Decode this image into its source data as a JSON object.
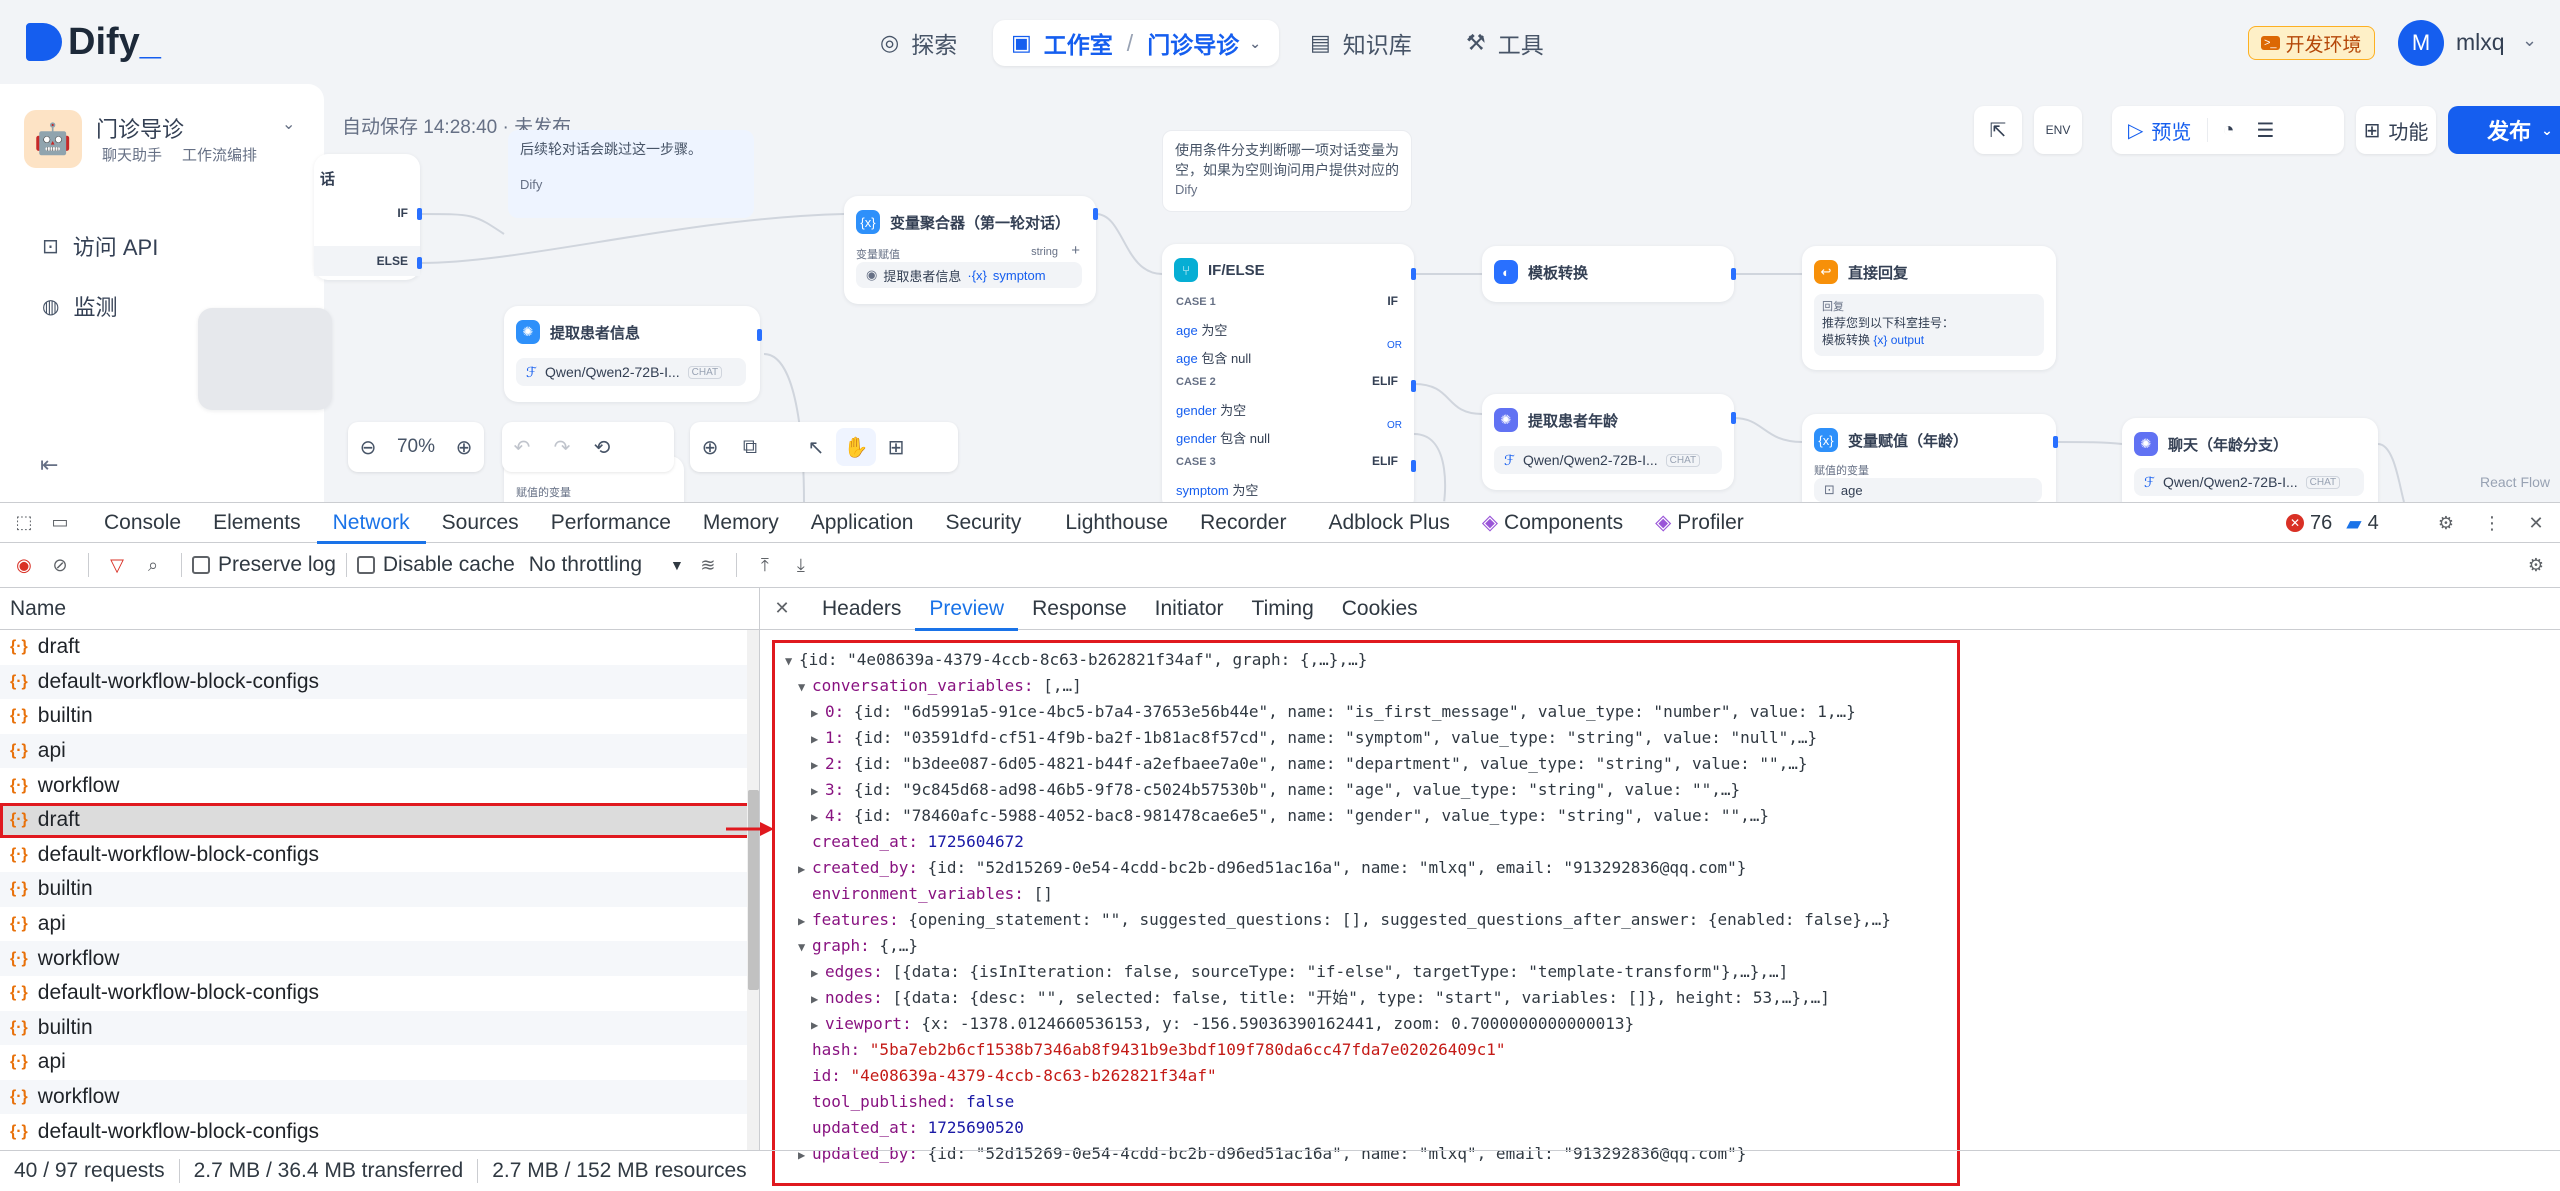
{
  "dify": {
    "brand": "Dify",
    "nav": {
      "explore": "探索",
      "studio": "工作室",
      "studio_app": "门诊导诊",
      "knowledge": "知识库",
      "tools": "工具"
    },
    "env_badge": "开发环境",
    "user": {
      "initial": "M",
      "name": "mlxq"
    },
    "sidebar": {
      "app_name": "门诊导诊",
      "app_tag1": "聊天助手",
      "app_tag2": "工作流编排",
      "items": [
        {
          "label": "访问 API",
          "icon": "terminal-icon"
        },
        {
          "label": "监测",
          "icon": "monitor-icon"
        }
      ]
    },
    "canvas": {
      "autosave": "自动保存 14:28:40 · 未发布",
      "toolbar": {
        "preview": "预览",
        "features": "功能",
        "publish": "发布"
      },
      "zoom": "70%",
      "react_flow": "React Flow",
      "notes": {
        "left_note": "后续轮对话会跳过这一步骤。",
        "left_note_author": "Dify",
        "right_note": "使用条件分支判断哪一项对话变量为空，如果为空则询问用户提供对应的",
        "right_note_author": "Dify"
      },
      "nodes": {
        "if_partial": {
          "title": "话",
          "if": "IF",
          "else": "ELSE"
        },
        "extract_patient": {
          "title": "提取患者信息",
          "model": "Qwen/Qwen2-72B-I...",
          "badge": "CHAT"
        },
        "var_aggregator": {
          "title": "变量聚合器（第一轮对话）",
          "label": "变量赋值",
          "type": "string",
          "var_src": "提取患者信息",
          "var": "symptom"
        },
        "ifelse": {
          "title": "IF/ELSE",
          "cases": [
            {
              "name": "CASE 1",
              "tag": "IF",
              "conds": [
                {
                  "var": "age",
                  "op": "为空"
                },
                {
                  "var": "age",
                  "op": "包含 null"
                }
              ]
            },
            {
              "name": "CASE 2",
              "tag": "ELIF",
              "conds": [
                {
                  "var": "gender",
                  "op": "为空"
                },
                {
                  "var": "gender",
                  "op": "包含 null"
                }
              ]
            },
            {
              "name": "CASE 3",
              "tag": "ELIF",
              "conds": [
                {
                  "var": "symptom",
                  "op": "为空"
                }
              ]
            }
          ],
          "or": "OR"
        },
        "template": {
          "title": "模板转换"
        },
        "direct_reply": {
          "title": "直接回复",
          "label": "回复",
          "text": "推荐您到以下科室挂号：",
          "src": "模板转换",
          "var": "output"
        },
        "extract_age": {
          "title": "提取患者年龄",
          "model": "Qwen/Qwen2-72B-I...",
          "badge": "CHAT"
        },
        "var_assign_age": {
          "title": "变量赋值（年龄）",
          "label": "赋值的变量",
          "var": "age"
        },
        "chat_age": {
          "title": "聊天（年龄分支）",
          "model": "Qwen/Qwen2-72B-I...",
          "badge": "CHAT"
        },
        "bottom_partial": {
          "label": "赋值的变量"
        }
      }
    }
  },
  "devtools": {
    "tabs": [
      "Console",
      "Elements",
      "Network",
      "Sources",
      "Performance",
      "Memory",
      "Application",
      "Security",
      "Lighthouse",
      "Recorder",
      "Adblock Plus",
      "Components",
      "Profiler"
    ],
    "active_tab": "Network",
    "errors": "76",
    "messages": "4",
    "network_toolbar": {
      "preserve_log": "Preserve log",
      "disable_cache": "Disable cache",
      "throttling": "No throttling"
    },
    "name_header": "Name",
    "requests": [
      "draft",
      "default-workflow-block-configs",
      "builtin",
      "api",
      "workflow",
      "draft",
      "default-workflow-block-configs",
      "builtin",
      "api",
      "workflow",
      "default-workflow-block-configs",
      "builtin",
      "api",
      "workflow",
      "default-workflow-block-configs"
    ],
    "selected_index": 5,
    "detail_tabs": [
      "Headers",
      "Preview",
      "Response",
      "Initiator",
      "Timing",
      "Cookies"
    ],
    "active_detail_tab": "Preview",
    "status": {
      "requests": "40 / 97 requests",
      "transferred": "2.7 MB / 36.4 MB transferred",
      "resources": "2.7 MB / 152 MB resources"
    },
    "preview_lines": [
      {
        "indent": 0,
        "tri": "▼",
        "text": "{id: \"4e08639a-4379-4ccb-8c63-b262821f34af\", graph: {,…},…}"
      },
      {
        "indent": 1,
        "tri": "▼",
        "key": "conversation_variables",
        "text": "[,…]"
      },
      {
        "indent": 2,
        "tri": "▶",
        "key": "0",
        "text": "{id: \"6d5991a5-91ce-4bc5-b7a4-37653e56b44e\", name: \"is_first_message\", value_type: \"number\", value: 1,…}"
      },
      {
        "indent": 2,
        "tri": "▶",
        "key": "1",
        "text": "{id: \"03591dfd-cf51-4f9b-ba2f-1b81ac8f57cd\", name: \"symptom\", value_type: \"string\", value: \"null\",…}"
      },
      {
        "indent": 2,
        "tri": "▶",
        "key": "2",
        "text": "{id: \"b3dee087-6d05-4821-b44f-a2efbaee7a0e\", name: \"department\", value_type: \"string\", value: \"\",…}"
      },
      {
        "indent": 2,
        "tri": "▶",
        "key": "3",
        "text": "{id: \"9c845d68-ad98-46b5-9f78-c5024b57530b\", name: \"age\", value_type: \"string\", value: \"\",…}"
      },
      {
        "indent": 2,
        "tri": "▶",
        "key": "4",
        "text": "{id: \"78460afc-5988-4052-bac8-981478cae6e5\", name: \"gender\", value_type: \"string\", value: \"\",…}"
      },
      {
        "indent": 1,
        "tri": "",
        "key": "created_at",
        "num": "1725604672"
      },
      {
        "indent": 1,
        "tri": "▶",
        "key": "created_by",
        "text": "{id: \"52d15269-0e54-4cdd-bc2b-d96ed51ac16a\", name: \"mlxq\", email: \"913292836@qq.com\"}"
      },
      {
        "indent": 1,
        "tri": "",
        "key": "environment_variables",
        "text": "[]"
      },
      {
        "indent": 1,
        "tri": "▶",
        "key": "features",
        "text": "{opening_statement: \"\", suggested_questions: [], suggested_questions_after_answer: {enabled: false},…}"
      },
      {
        "indent": 1,
        "tri": "▼",
        "key": "graph",
        "text": "{,…}"
      },
      {
        "indent": 2,
        "tri": "▶",
        "key": "edges",
        "text": "[{data: {isInIteration: false, sourceType: \"if-else\", targetType: \"template-transform\"},…},…]"
      },
      {
        "indent": 2,
        "tri": "▶",
        "key": "nodes",
        "text": "[{data: {desc: \"\", selected: false, title: \"开始\", type: \"start\", variables: []}, height: 53,…},…]"
      },
      {
        "indent": 2,
        "tri": "▶",
        "key": "viewport",
        "text": "{x: -1378.0124660536153, y: -156.59036390162441, zoom: 0.7000000000000013}"
      },
      {
        "indent": 1,
        "tri": "",
        "key": "hash",
        "str": "\"5ba7eb2b6cf1538b7346ab8f9431b9e3bdf109f780da6cc47fda7e02026409c1\""
      },
      {
        "indent": 1,
        "tri": "",
        "key": "id",
        "str": "\"4e08639a-4379-4ccb-8c63-b262821f34af\""
      },
      {
        "indent": 1,
        "tri": "",
        "key": "tool_published",
        "num": "false"
      },
      {
        "indent": 1,
        "tri": "",
        "key": "updated_at",
        "num": "1725690520"
      },
      {
        "indent": 1,
        "tri": "▶",
        "key": "updated_by",
        "text": "{id: \"52d15269-0e54-4cdd-bc2b-d96ed51ac16a\", name: \"mlxq\", email: \"913292836@qq.com\"}"
      }
    ]
  },
  "colors": {
    "accent": "#155eef",
    "devtools_blue": "#1a73e8",
    "highlight_red": "#e0191f"
  }
}
